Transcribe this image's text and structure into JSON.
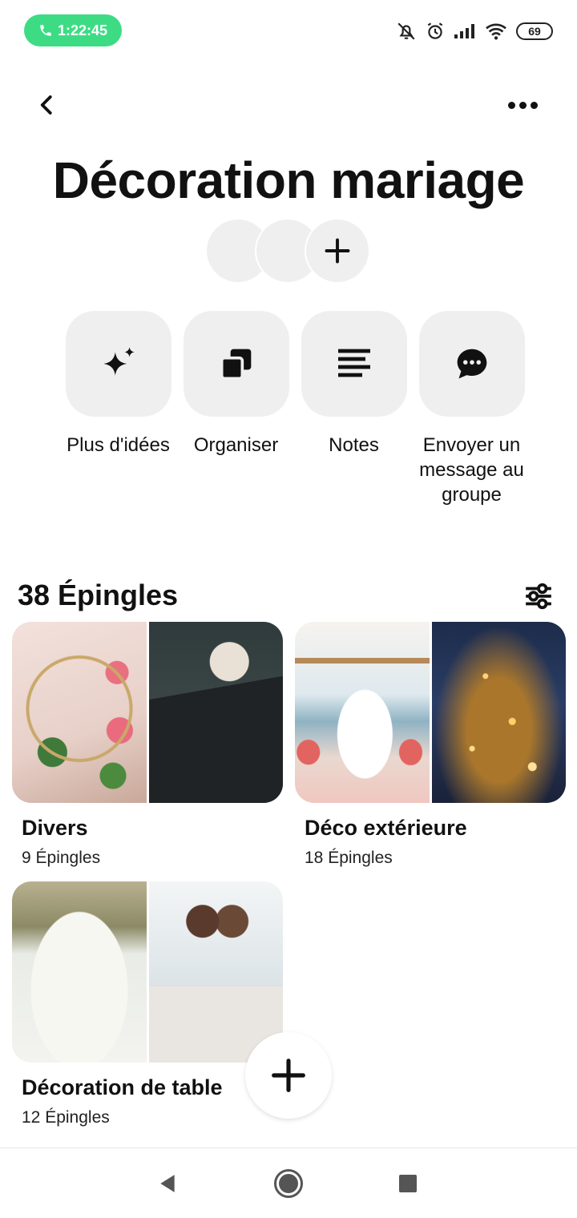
{
  "status_bar": {
    "call_timer": "1:22:45",
    "battery_level": "69",
    "accent_color": "#3ddc84",
    "icons": [
      "mute-icon",
      "alarm-icon",
      "signal-icon",
      "wifi-icon",
      "battery-icon"
    ]
  },
  "header": {
    "back_icon": "chevron-left-icon",
    "more_icon": "more-horizontal-icon"
  },
  "board": {
    "title": "Décoration mariage"
  },
  "actions": [
    {
      "label": "Plus d'idées",
      "icon": "sparkle-icon"
    },
    {
      "label": "Organiser",
      "icon": "organize-icon"
    },
    {
      "label": "Notes",
      "icon": "notes-icon"
    },
    {
      "label": "Envoyer un message au groupe",
      "icon": "chat-bubble-icon"
    }
  ],
  "pins": {
    "count_label": "38 Épingles",
    "filter_icon": "filter-sliders-icon"
  },
  "sections": [
    {
      "name": "Divers",
      "count": "9 Épingles"
    },
    {
      "name": "Déco extérieure",
      "count": "18 Épingles"
    },
    {
      "name": "Décoration de table",
      "count": "12 Épingles"
    }
  ],
  "nav_bar": {
    "icons": [
      "nav-back-icon",
      "nav-home-icon",
      "nav-recents-icon"
    ]
  }
}
